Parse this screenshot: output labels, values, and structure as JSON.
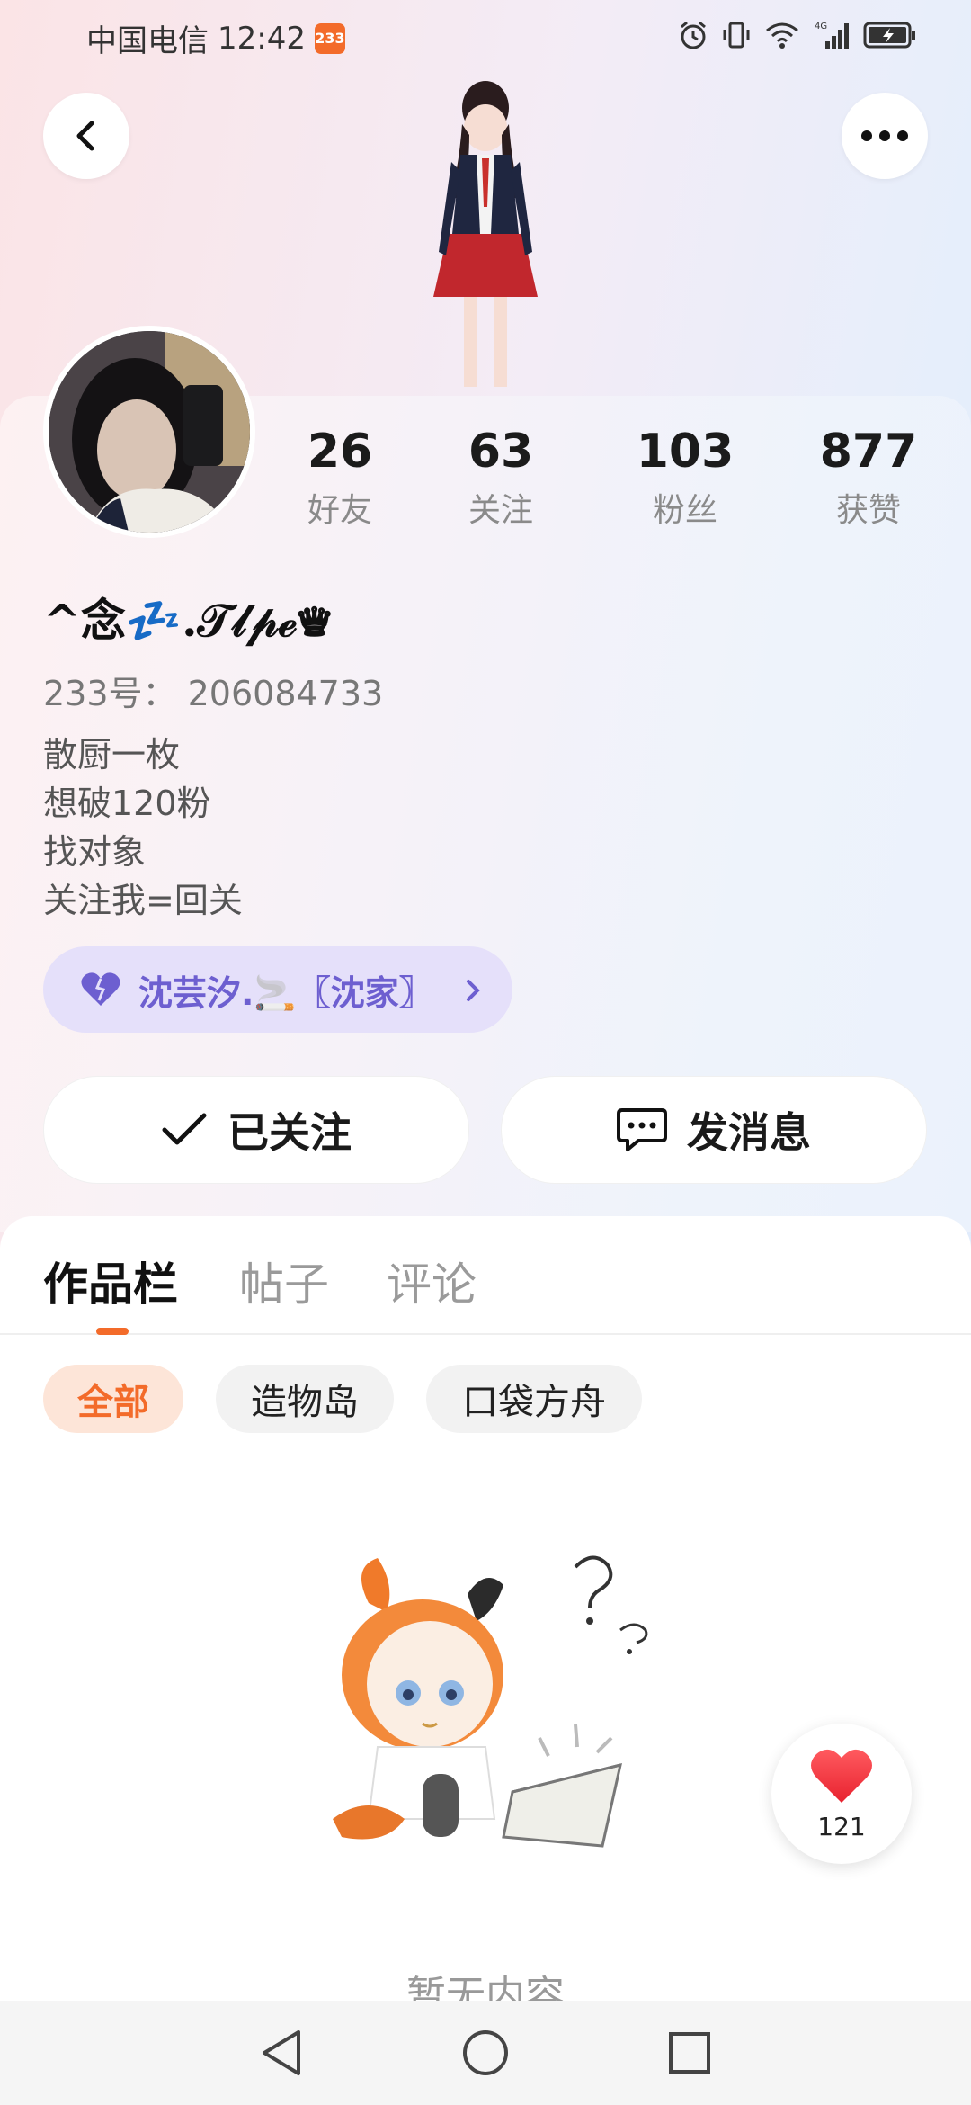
{
  "status_bar": {
    "carrier": "中国电信",
    "time": "12:42",
    "badge": "233"
  },
  "profile": {
    "nickname": "^念💤.𝒯𝓁𝓅ℯ♛",
    "uid": "233号：  206084733",
    "bio": [
      "散厨一枚",
      "想破120粉",
      "找对象",
      "关注我=回关"
    ],
    "stats": [
      {
        "value": "26",
        "label": "好友"
      },
      {
        "value": "63",
        "label": "关注"
      },
      {
        "value": "103",
        "label": "粉丝"
      },
      {
        "value": "877",
        "label": "获赞"
      }
    ],
    "group": "沈芸汐.🚬〖沈家〗"
  },
  "actions": {
    "follow_label": "已关注",
    "message_label": "发消息"
  },
  "tabs": [
    "作品栏",
    "帖子",
    "评论"
  ],
  "filters": [
    "全部",
    "造物岛",
    "口袋方舟"
  ],
  "empty_text": "暂无内容",
  "like_count": "121",
  "colors": {
    "accent": "#f36b2a",
    "group_text": "#6d5fd0",
    "group_bg": "#e5e0fa"
  }
}
